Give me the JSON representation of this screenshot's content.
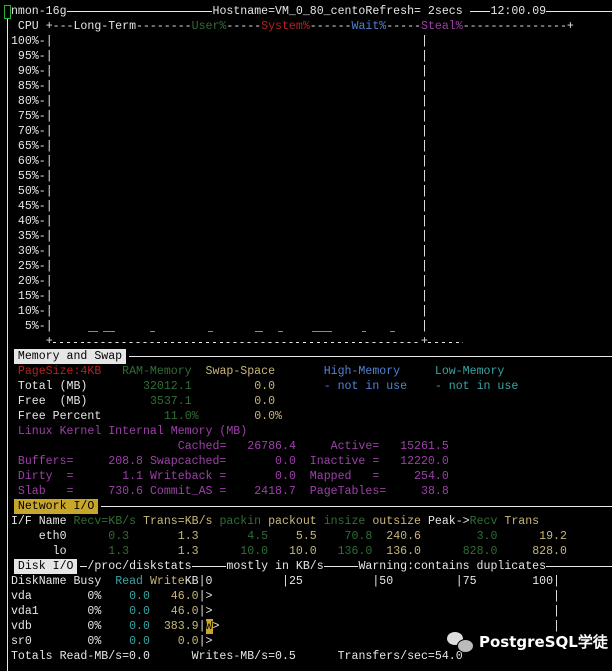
{
  "title": {
    "app": "nmon-16g",
    "hostname": "Hostname=VM_0_80_cento",
    "refresh": "Refresh= 2secs",
    "time": "12:00.09"
  },
  "cpu": {
    "label": "CPU",
    "long_term": "+---Long-Term--------",
    "user": "User%",
    "sep1": "-----",
    "system": "System%",
    "sep2": "------",
    "wait": "Wait%",
    "sep3": "-----",
    "steal": "Steal%",
    "tail": "---------------+",
    "y_labels": [
      "100%-",
      "95%-",
      "90%-",
      "85%-",
      "80%-",
      "75%-",
      "70%-",
      "65%-",
      "60%-",
      "55%-",
      "50%-",
      "45%-",
      "40%-",
      "35%-",
      "30%-",
      "25%-",
      "20%-",
      "15%-",
      "10%-",
      "5%-"
    ]
  },
  "memory": {
    "section_title": "Memory and Swap",
    "headers": {
      "pagesize": "PageSize:4KB",
      "ram": "RAM-Memory",
      "swap": "Swap-Space",
      "high": "High-Memory",
      "low": "Low-Memory"
    },
    "total": {
      "label": "Total (MB)",
      "ram": "32012.1",
      "swap": "0.0",
      "high": "- not in use",
      "low": "- not in use"
    },
    "free": {
      "label": "Free  (MB)",
      "ram": "3537.1",
      "swap": "0.0"
    },
    "free_percent": {
      "label": "Free Percent",
      "ram": "11.0%",
      "swap": "0.0%"
    },
    "kernel": {
      "title": "Linux Kernel Internal Memory (MB)",
      "cached_label": "Cached=",
      "cached": "26786.4",
      "active_label": "Active=",
      "active": "15261.5",
      "buffers_label": "Buffers=",
      "buffers": "208.8",
      "swapcached_label": "Swapcached=",
      "swapcached": "0.0",
      "inactive_label": "Inactive =",
      "inactive": "12220.0",
      "dirty_label": "Dirty  =",
      "dirty": "1.1",
      "writeback_label": "Writeback =",
      "writeback": "0.0",
      "mapped_label": "Mapped   =",
      "mapped": "254.0",
      "slab_label": "Slab   =",
      "slab": "730.6",
      "commit_label": "Commit_AS =",
      "commit": "2418.7",
      "pagetables_label": "PageTables=",
      "pagetables": "38.8"
    }
  },
  "network": {
    "section_title": "Network I/O",
    "headers": [
      "I/F Name",
      "Recv=KB/s",
      "Trans=KB/s",
      "packin",
      "packout",
      "insize",
      "outsize",
      "Peak->",
      "Recv",
      "Trans"
    ],
    "rows": [
      {
        "name": "eth0",
        "recv": "0.3",
        "trans": "1.3",
        "packin": "4.5",
        "packout": "5.5",
        "insize": "70.8",
        "outsize": "240.6",
        "peak_recv": "3.0",
        "peak_trans": "19.2"
      },
      {
        "name": "lo",
        "recv": "1.3",
        "trans": "1.3",
        "packin": "10.0",
        "packout": "10.0",
        "insize": "136.0",
        "outsize": "136.0",
        "peak_recv": "828.0",
        "peak_trans": "828.0"
      }
    ]
  },
  "disk": {
    "section_title": "Disk I/O",
    "source": "/proc/diskstats",
    "units": "mostly in KB/s",
    "warning": "Warning:contains duplicates",
    "headers": {
      "name_busy": "DiskName Busy",
      "read": "Read",
      "write": "Write",
      "kb": "KB|0",
      "s25": "|25",
      "s50": "|50",
      "s75": "|75",
      "s100": "100|"
    },
    "rows": [
      {
        "name": "vda",
        "busy": "0%",
        "read": "0.0",
        "write": "46.0",
        "bar": "|>"
      },
      {
        "name": "vda1",
        "busy": "0%",
        "read": "0.0",
        "write": "46.0",
        "bar": "|>"
      },
      {
        "name": "vdb",
        "busy": "0%",
        "read": "0.0",
        "write": "383.9",
        "bar": "|",
        "bar_w": "W",
        "bar_end": ">"
      },
      {
        "name": "sr0",
        "busy": "0%",
        "read": "0.0",
        "write": "0.0",
        "bar": "|>"
      }
    ],
    "totals": {
      "read": "Totals Read-MB/s=0.0",
      "writes": "Writes-MB/s=0.5",
      "transfers": "Transfers/sec=54.0"
    }
  },
  "watermark": {
    "text": "PostgreSQL学徒"
  }
}
